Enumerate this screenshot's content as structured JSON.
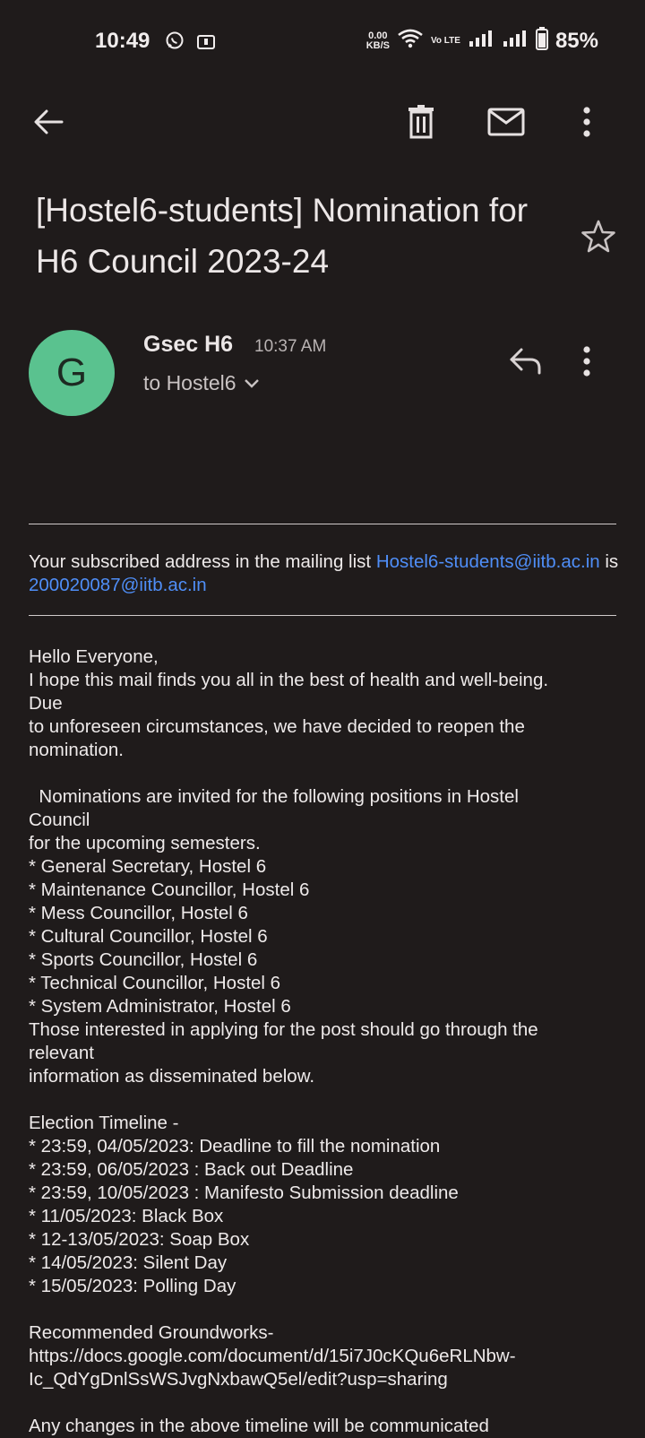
{
  "status_bar": {
    "time": "10:49",
    "net_speed_value": "0.00",
    "net_speed_unit": "KB/S",
    "volte_label": "Vo LTE",
    "battery": "85%"
  },
  "email": {
    "subject": "[Hostel6-students] Nomination for H6 Council 2023-24",
    "sender_initial": "G",
    "sender_name": "Gsec H6",
    "time": "10:37 AM",
    "recipient": "to Hostel6",
    "subscribed": {
      "prefix": "Your subscribed address in the mailing list ",
      "list_address": "Hostel6-students@iitb.ac.in",
      "middle": " is ",
      "user_address": "200020087@iitb.ac.in"
    },
    "body_lines": [
      "Hello Everyone,",
      "I hope this mail finds you all in the best of health and well-being.",
      "Due",
      "to unforeseen circumstances, we have decided to reopen the",
      "nomination.",
      "",
      "  Nominations are invited for the following positions in Hostel",
      "Council",
      "for the upcoming semesters.",
      "* General Secretary, Hostel 6",
      "* Maintenance Councillor, Hostel 6",
      "* Mess Councillor, Hostel 6",
      "* Cultural Councillor, Hostel 6",
      "* Sports Councillor, Hostel 6",
      "* Technical Councillor, Hostel 6",
      "* System Administrator, Hostel 6",
      "Those interested in applying for the post should go through the",
      "relevant",
      "information as disseminated below.",
      "",
      "Election Timeline -",
      "* 23:59, 04/05/2023: Deadline to fill the nomination",
      "* 23:59, 06/05/2023 : Back out Deadline",
      "* 23:59, 10/05/2023 : Manifesto Submission deadline",
      "* 11/05/2023: Black Box",
      "* 12-13/05/2023: Soap Box",
      "* 14/05/2023: Silent Day",
      "* 15/05/2023: Polling Day",
      "",
      "Recommended Groundworks-",
      "https://docs.google.com/document/d/15i7J0cKQu6eRLNbw-",
      "Ic_QdYgDnlSsWSJvgNxbawQ5el/edit?usp=sharing",
      "",
      "Any changes in the above timeline will be communicated"
    ]
  },
  "icons": {
    "back": "arrow-left-icon",
    "delete": "trash-icon",
    "mark_unread": "mail-icon",
    "more": "more-vert-icon",
    "star": "star-outline-icon",
    "reply": "reply-icon",
    "expand": "chevron-down-icon"
  },
  "colors": {
    "background": "#1f1b1b",
    "avatar": "#5ac28f",
    "link": "#4f8ef7"
  }
}
